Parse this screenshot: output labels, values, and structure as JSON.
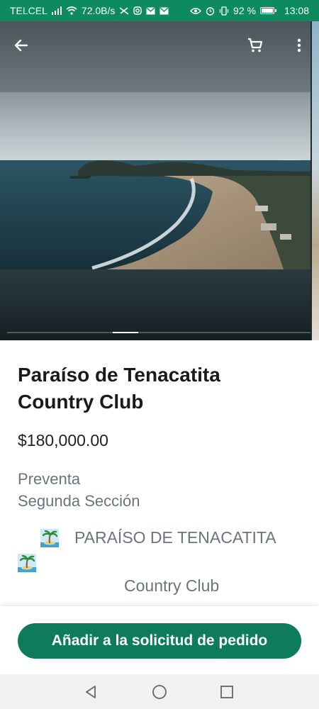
{
  "status_bar": {
    "carrier": "TELCEL",
    "speed": "72.0B/s",
    "battery": "92 %",
    "time": "13:08",
    "icons": [
      "signal-icon",
      "wifi-icon",
      "mute-icon",
      "instagram-icon",
      "mail-icon",
      "mail-icon",
      "eye-icon",
      "alarm-icon",
      "vibrate-icon",
      "battery-icon"
    ]
  },
  "toolbar": {
    "back_icon": "arrow-left-icon",
    "cart_icon": "shopping-cart-icon",
    "menu_icon": "more-vert-icon"
  },
  "carousel": {
    "image_description": "aerial-beach-photo",
    "active_index": 3,
    "indicator_count": 12
  },
  "product": {
    "title": "Paraíso de Tenacatita Country Club",
    "price": "$180,000.00",
    "category_line1": "Preventa",
    "category_line2": "Segunda Sección",
    "desc_line1": "PARAÍSO DE TENACATITA",
    "desc_line3": "Country Club"
  },
  "actions": {
    "add_to_order": "Añadir a la solicitud de pedido"
  },
  "colors": {
    "brand_green": "#0e7c5c",
    "status_green": "#0e8a5f"
  }
}
